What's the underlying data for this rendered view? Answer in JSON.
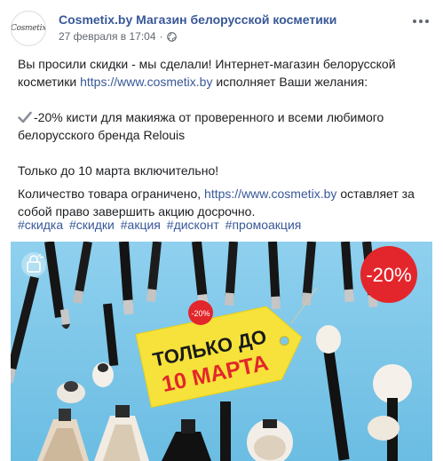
{
  "post": {
    "page_name": "Cosmetix.by Магазин белорусской косметики",
    "avatar_text": "Cosmetix",
    "timestamp": "27 февраля в 17:04",
    "separator": "·"
  },
  "content": {
    "line1_part1": "Вы просили скидки - мы сделали! Интернет-магазин белорусской косметики",
    "line1_link": "https://www.cosmetix.by",
    "line1_part2": "исполняет Ваши желания:",
    "offer_text": "-20% кисти для макияжа от проверенного и всеми любимого белорусского бренда Relouis",
    "deadline_text": "Только до 10 марта включительно!",
    "limited_part1": "Количество товара ограничено,",
    "limited_link": "https://www.cosmetix.by",
    "limited_part2": "оставляет за собой право завершить акцию досрочно."
  },
  "hashtags": [
    "#скидка",
    "#скидки",
    "#акция",
    "#дисконт",
    "#промоакция"
  ],
  "image": {
    "tag_line1": "ТОЛЬКО ДО",
    "tag_line2": "10 МАРТА",
    "tag_badge": "-20%",
    "discount_badge": "-20%"
  },
  "colors": {
    "link": "#385898",
    "image_bg": "#7dc6e8",
    "tag_yellow": "#f6e23a",
    "badge_red": "#e3262b"
  }
}
